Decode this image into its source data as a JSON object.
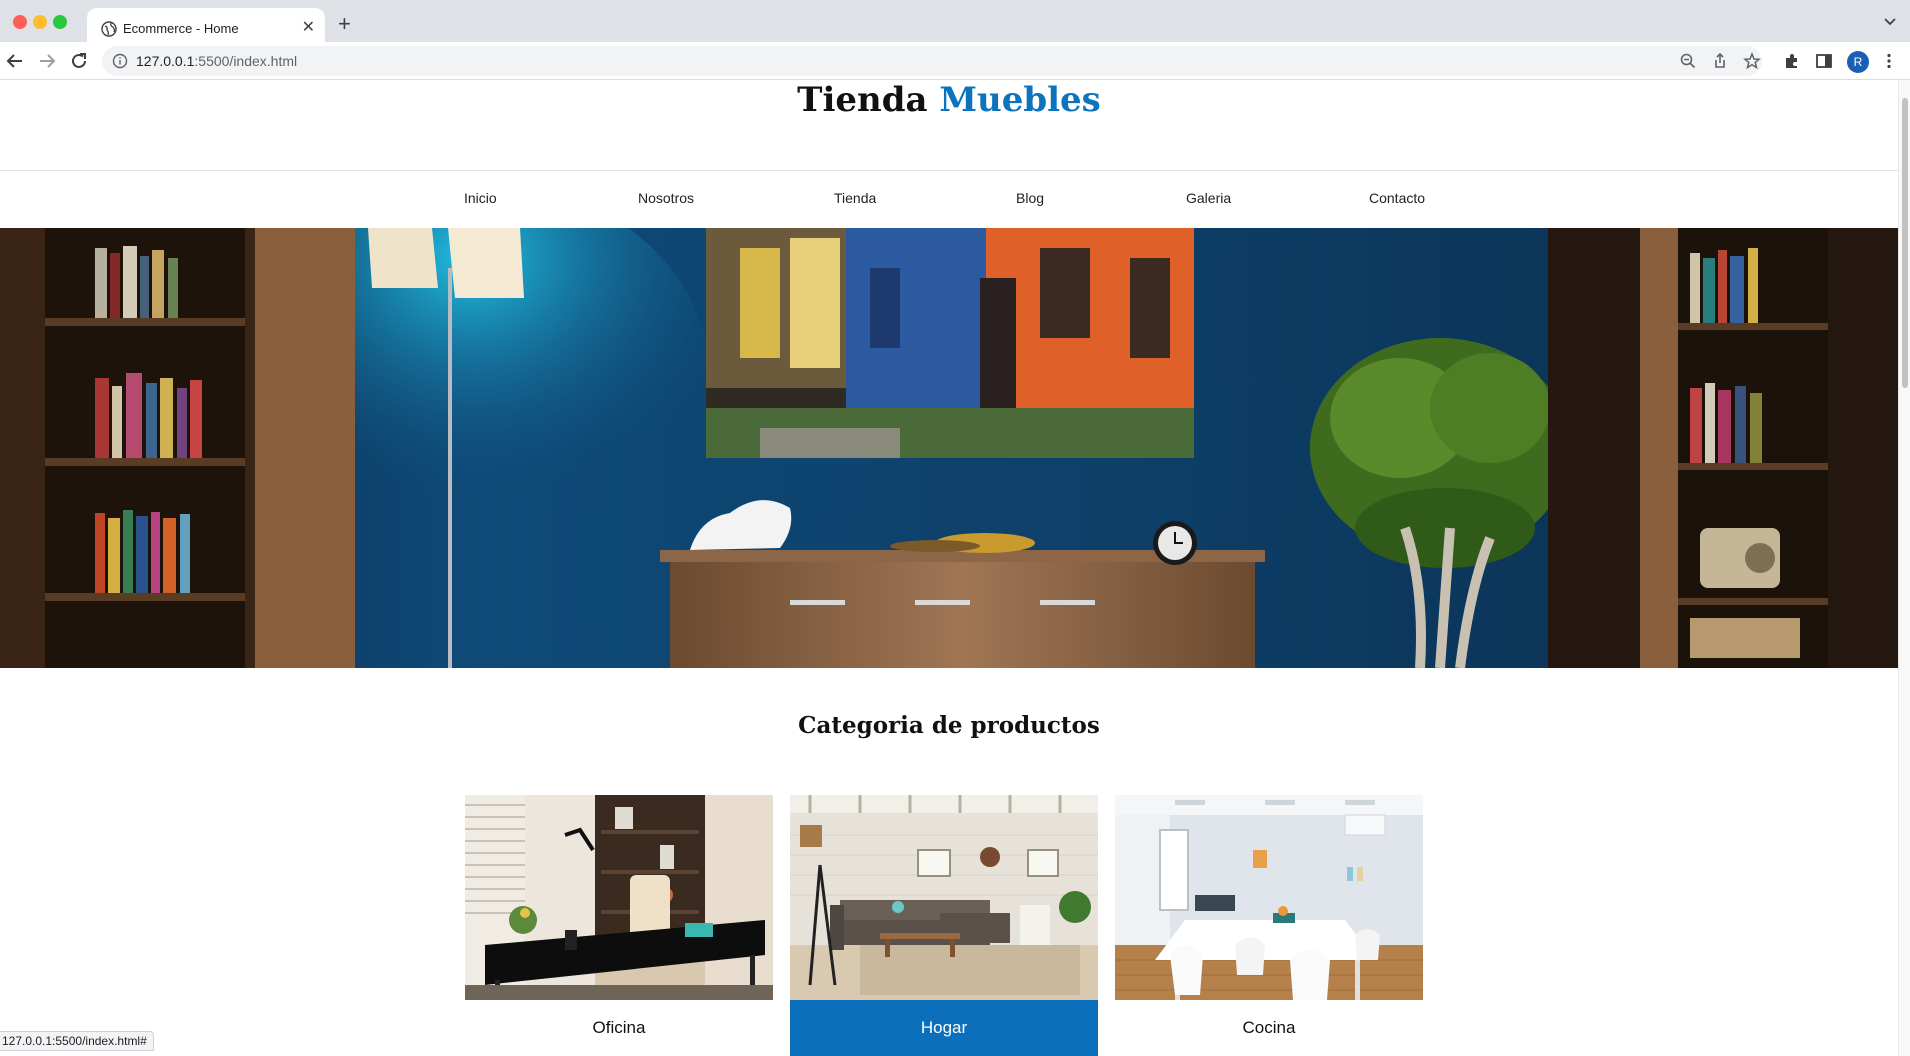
{
  "browser": {
    "tab_title": "Ecommerce - Home",
    "url_host": "127.0.0.1",
    "url_path": ":5500/index.html",
    "profile_initial": "R",
    "status_url": "127.0.0.1:5500/index.html#"
  },
  "site": {
    "title_main": "Tienda ",
    "title_accent": "Muebles",
    "accent_color": "#0b74bd"
  },
  "nav": {
    "items": [
      "Inicio",
      "Nosotros",
      "Tienda",
      "Blog",
      "Galeria",
      "Contacto"
    ]
  },
  "categories": {
    "heading": "Categoria de productos",
    "items": [
      {
        "label": "Oficina"
      },
      {
        "label": "Hogar"
      },
      {
        "label": "Cocina"
      }
    ],
    "active_color": "#0b6fbc"
  }
}
